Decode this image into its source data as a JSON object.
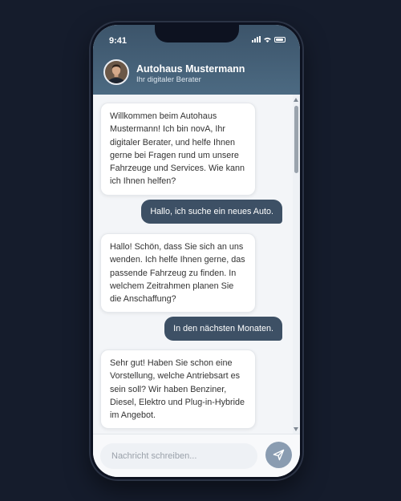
{
  "status": {
    "time": "9:41"
  },
  "header": {
    "title": "Autohaus Mustermann",
    "subtitle": "Ihr digitaler Berater",
    "avatar": "advisor-avatar"
  },
  "messages": [
    {
      "from": "bot",
      "text": "Willkommen beim Autohaus Mustermann! Ich bin novA, Ihr digitaler Berater, und helfe Ihnen gerne bei Fragen rund um unsere Fahrzeuge und Services. Wie kann ich Ihnen helfen?"
    },
    {
      "from": "user",
      "text": "Hallo, ich suche ein neues Auto."
    },
    {
      "from": "bot",
      "text": "Hallo! Schön, dass Sie sich an uns wenden. Ich helfe Ihnen gerne, das passende Fahrzeug zu finden. In welchem Zeitrahmen planen Sie die Anschaffung?"
    },
    {
      "from": "user",
      "text": "In den nächsten Monaten."
    },
    {
      "from": "bot",
      "text": "Sehr gut! Haben Sie schon eine Vorstellung, welche Antriebsart es sein soll? Wir haben Benziner, Diesel, Elektro und Plug-in-Hybride im Angebot."
    }
  ],
  "composer": {
    "placeholder": "Nachricht schreiben...",
    "send_icon": "send-icon"
  },
  "colors": {
    "header": "#4a647a",
    "user_bubble": "#3d5065",
    "send_button": "#8a9cb1",
    "background": "#151c2c"
  }
}
